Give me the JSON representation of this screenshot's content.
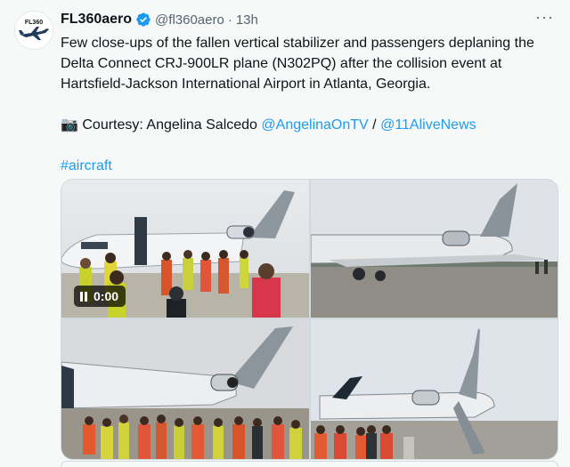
{
  "author": {
    "display_name": "FL360aero",
    "handle": "@fl360aero",
    "time_ago": "13h",
    "avatar_text": "FL360",
    "verified": true
  },
  "separator": "·",
  "more_label": "···",
  "tweet": {
    "line1": "Few close-ups of the fallen vertical stabilizer and passengers deplaning the",
    "line2": "Delta Connect CRJ-900LR plane (N302PQ) after the collision event at",
    "line3": "Hartsfield-Jackson International Airport in Atlanta, Georgia.",
    "camera_icon": "📷",
    "courtesy_prefix": "Courtesy: Angelina Salcedo",
    "mention1": "@AngelinaOnTV",
    "slash": "/",
    "mention2": "@11AliveNews",
    "hashtag": "#aircraft"
  },
  "media": {
    "video_time": "0:00",
    "pause_icon": "pause-icon"
  },
  "colors": {
    "link": "#1d9bf0",
    "verified": "#1d9bf0",
    "background": "#f7f9f9"
  }
}
